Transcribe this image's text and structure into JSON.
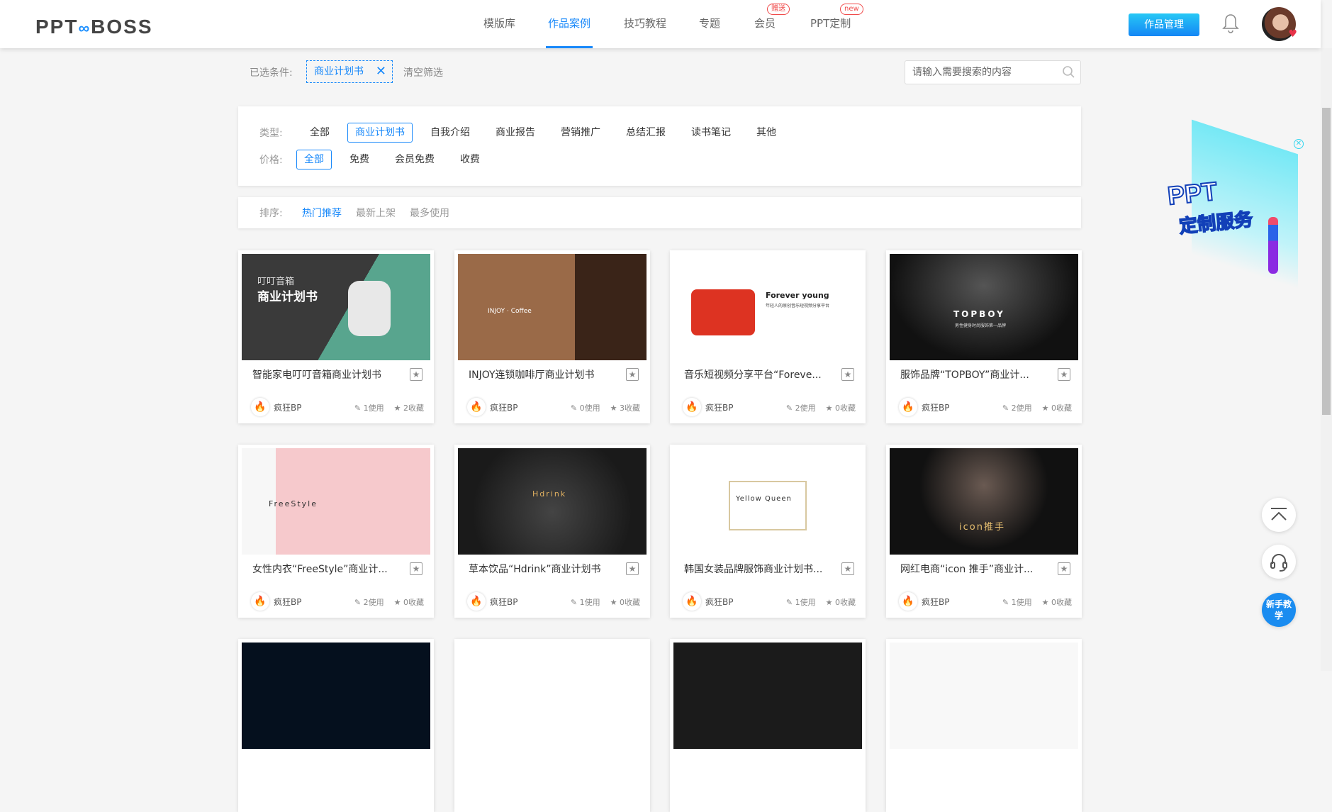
{
  "header": {
    "logo": "PPT∞BOSS",
    "logo_left": "PPT",
    "logo_right": "BOSS",
    "nav": [
      {
        "label": "模版库"
      },
      {
        "label": "作品案例",
        "active": true
      },
      {
        "label": "技巧教程"
      },
      {
        "label": "专题"
      },
      {
        "label": "会员",
        "badge": "赠送"
      },
      {
        "label": "PPT定制",
        "badge": "new"
      }
    ],
    "manage_button": "作品管理"
  },
  "selected": {
    "label": "已选条件:",
    "tag": "商业计划书",
    "clear": "清空筛选"
  },
  "search": {
    "placeholder": "请输入需要搜索的内容"
  },
  "filters": {
    "type_label": "类型:",
    "types": [
      "全部",
      "商业计划书",
      "自我介绍",
      "商业报告",
      "营销推广",
      "总结汇报",
      "读书笔记",
      "其他"
    ],
    "type_selected": "商业计划书",
    "price_label": "价格:",
    "prices": [
      "全部",
      "免费",
      "会员免费",
      "收费"
    ],
    "price_selected": "全部"
  },
  "sort": {
    "label": "排序:",
    "options": [
      "热门推荐",
      "最新上架",
      "最多使用"
    ],
    "selected": "热门推荐"
  },
  "cards": [
    {
      "title": "智能家电叮叮音箱商业计划书",
      "author": "疯狂BP",
      "uses": "1使用",
      "favs": "2收藏",
      "thumb": {
        "t1": "叮叮音箱",
        "t2": "商业计划书"
      }
    },
    {
      "title": "INJOY连锁咖啡厅商业计划书",
      "author": "疯狂BP",
      "uses": "0使用",
      "favs": "3收藏",
      "thumb": {
        "t1": "INJOY · Coffee"
      }
    },
    {
      "title": "音乐短视频分享平台“Foreve...",
      "author": "疯狂BP",
      "uses": "2使用",
      "favs": "0收藏",
      "thumb": {
        "t1": "Forever young",
        "t2": "年轻人的原创音乐短视频分享平台"
      }
    },
    {
      "title": "服饰品牌“TOPBOY”商业计...",
      "author": "疯狂BP",
      "uses": "2使用",
      "favs": "0收藏",
      "thumb": {
        "t1": "TOPBOY",
        "t2": "男性健身时尚服饰第一品牌"
      }
    },
    {
      "title": "女性内衣“FreeStyle”商业计...",
      "author": "疯狂BP",
      "uses": "2使用",
      "favs": "0收藏",
      "thumb": {
        "t1": "FreeStyle"
      }
    },
    {
      "title": "草本饮品“Hdrink”商业计划书",
      "author": "疯狂BP",
      "uses": "1使用",
      "favs": "0收藏",
      "thumb": {
        "t1": "Hdrink"
      }
    },
    {
      "title": "韩国女装品牌服饰商业计划书...",
      "author": "疯狂BP",
      "uses": "1使用",
      "favs": "0收藏",
      "thumb": {
        "t1": "Yellow Queen"
      }
    },
    {
      "title": "网红电商“icon 推手”商业计...",
      "author": "疯狂BP",
      "uses": "1使用",
      "favs": "0收藏",
      "thumb": {
        "t1": "icon推手"
      }
    }
  ],
  "promo": {
    "line1": "PPT",
    "line2": "定制服务"
  },
  "float": {
    "help": "新手教学"
  }
}
